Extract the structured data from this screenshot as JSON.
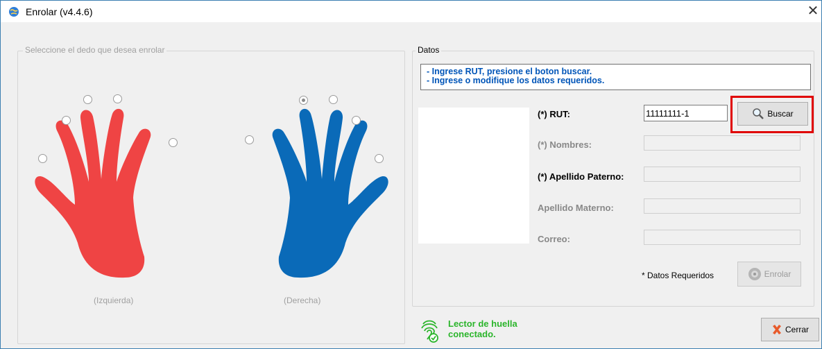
{
  "window": {
    "title": "Enrolar (v4.4.6)"
  },
  "finger_panel": {
    "legend": "Seleccione el dedo que desea enrolar",
    "left_hand": {
      "label": "(Izquierda)",
      "color": "#ef4444"
    },
    "right_hand": {
      "label": "(Derecha)",
      "color": "#0a6ab8"
    },
    "selected_finger": "right-thumb"
  },
  "data_panel": {
    "legend": "Datos",
    "instructions": [
      "- Ingrese RUT, presione el boton buscar.",
      "- Ingrese o modifique los datos requeridos."
    ],
    "fields": {
      "rut": {
        "label": "(*) RUT:",
        "value": "11111111-1"
      },
      "nombres": {
        "label": "(*) Nombres:",
        "value": ""
      },
      "apellido_paterno": {
        "label": "(*) Apellido Paterno:",
        "value": ""
      },
      "apellido_materno": {
        "label": "Apellido Materno:",
        "value": ""
      },
      "correo": {
        "label": "Correo:",
        "value": ""
      }
    },
    "buscar_label": "Buscar",
    "required_note": "* Datos Requeridos",
    "enrolar_label": "Enrolar"
  },
  "status": {
    "line1": "Lector de huella",
    "line2": "conectado."
  },
  "cerrar_label": "Cerrar",
  "colors": {
    "accent": "#0055b8",
    "status": "#2bb52b",
    "highlight": "#e00000"
  }
}
